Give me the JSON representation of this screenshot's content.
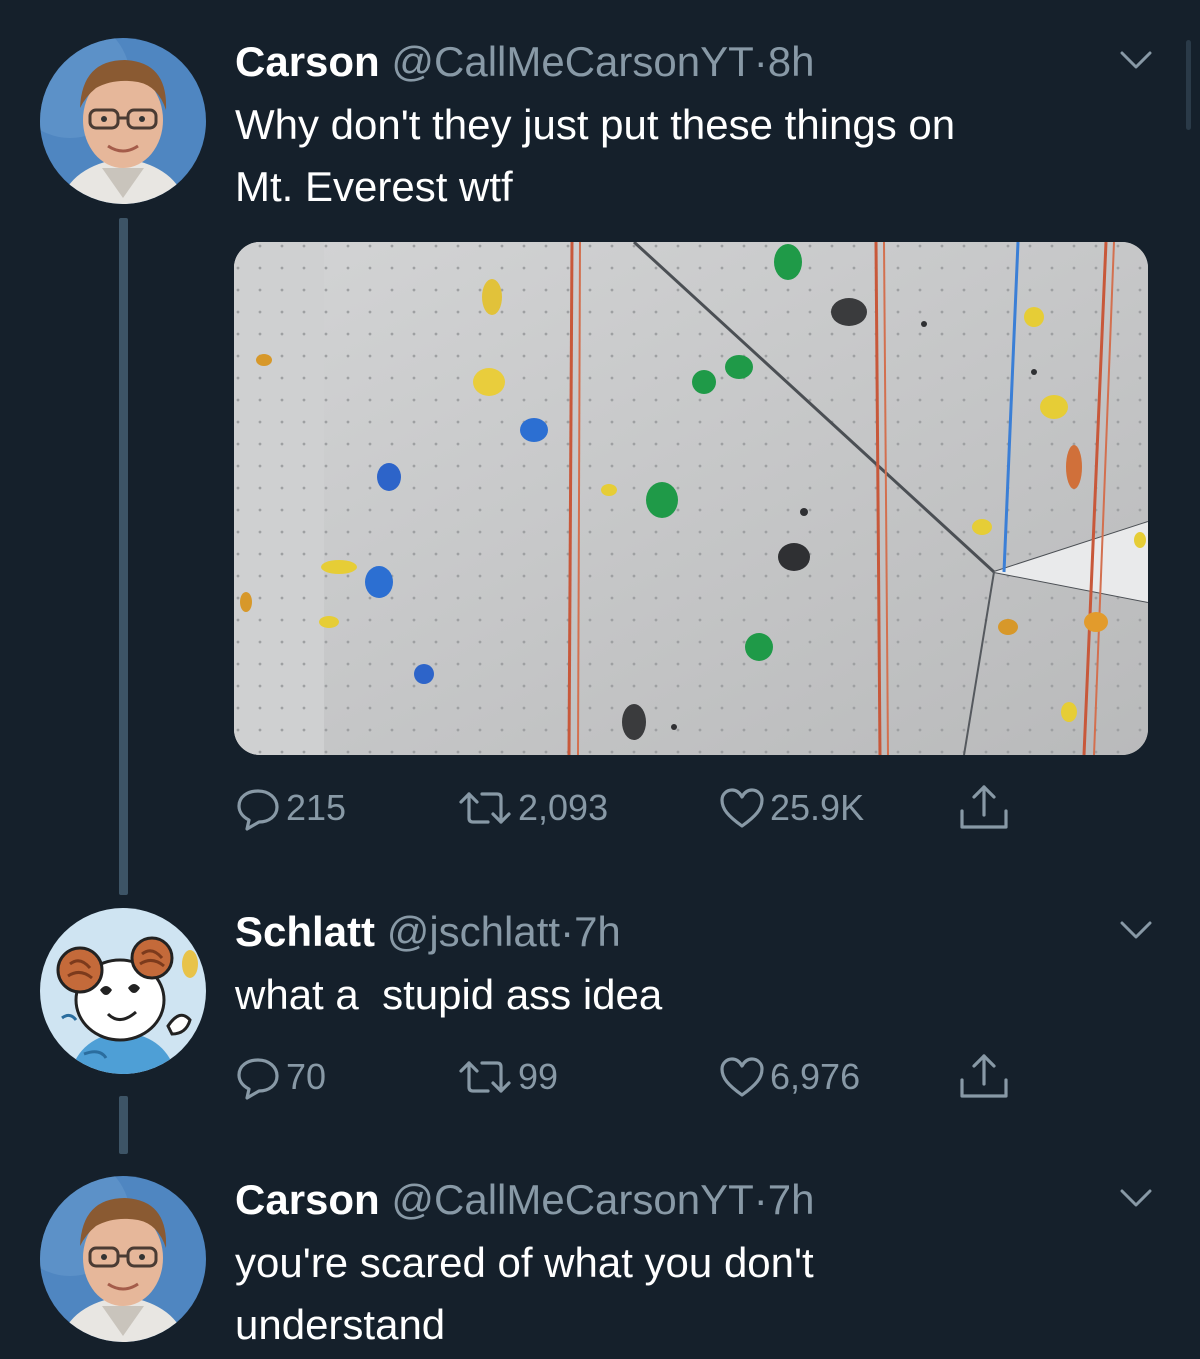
{
  "tweets": [
    {
      "name": "Carson",
      "handle": "@CallMeCarsonYT",
      "separator": "·",
      "time": "8h",
      "text": "Why don't they just put these things on\nMt. Everest wtf",
      "replies": "215",
      "retweets": "2,093",
      "likes": "25.9K"
    },
    {
      "name": "Schlatt",
      "handle": "@jschlatt",
      "separator": "·",
      "time": "7h",
      "text": "what a  stupid ass idea",
      "replies": "70",
      "retweets": "99",
      "likes": "6,976"
    },
    {
      "name": "Carson",
      "handle": "@CallMeCarsonYT",
      "separator": "·",
      "time": "7h",
      "text": "you're scared of what you don't\nunderstand"
    }
  ],
  "colors": {
    "background": "#15202b",
    "secondary_text": "#8899a6",
    "thread_line": "#3d5466"
  },
  "icons": {
    "reply": "reply-icon",
    "retweet": "retweet-icon",
    "like": "heart-icon",
    "share": "share-icon",
    "menu": "chevron-down-icon"
  }
}
